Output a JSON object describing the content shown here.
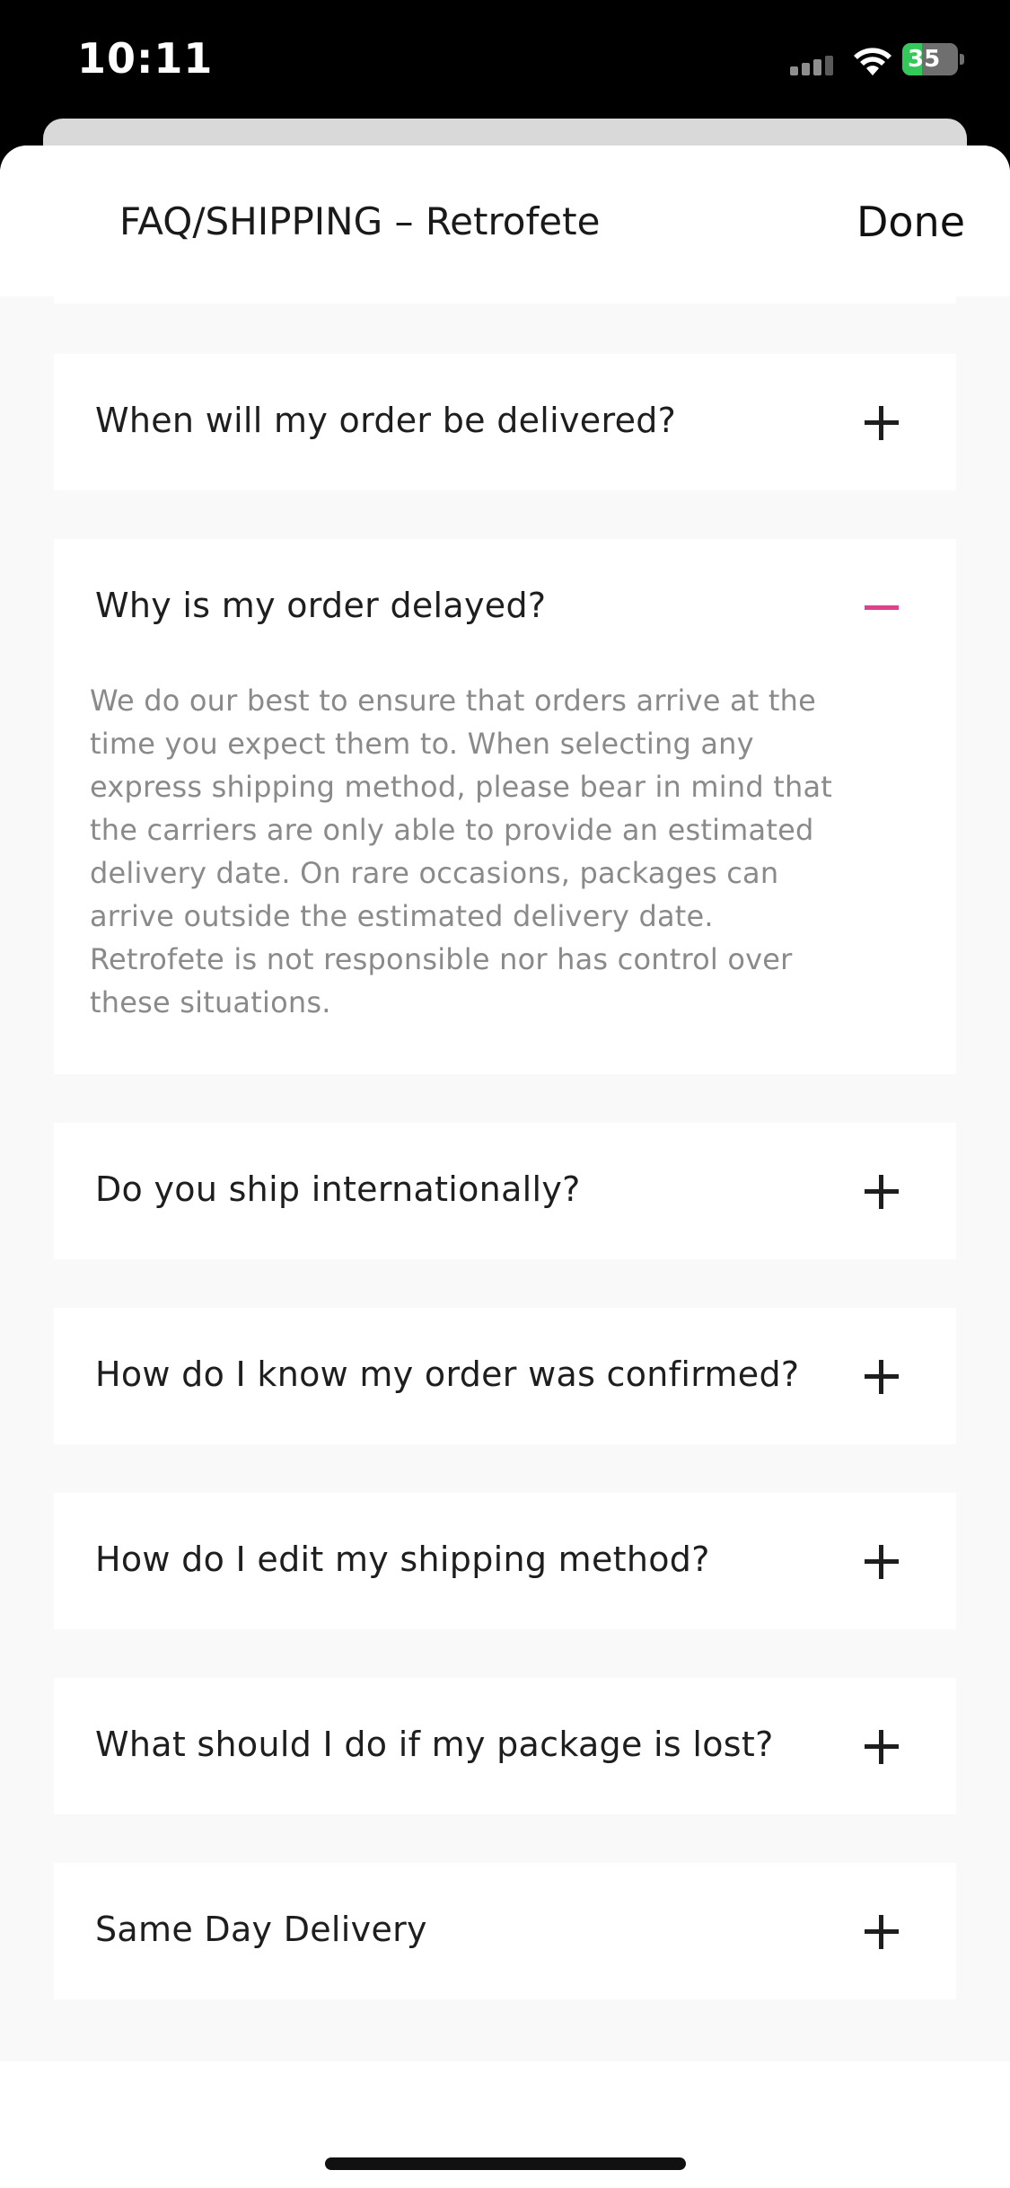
{
  "status_bar": {
    "time": "10:11",
    "battery_level": "35",
    "battery_color": "#34c759"
  },
  "header": {
    "title": "FAQ/SHIPPING – Retrofete",
    "done_label": "Done"
  },
  "accent_color": "#e0418f",
  "faq": {
    "items": [
      {
        "question": "When will my order be delivered?",
        "expanded": false,
        "icon": "plus-icon"
      },
      {
        "question": "Why is my order delayed?",
        "expanded": true,
        "icon": "minus-icon",
        "answer": "We do our best to ensure that orders arrive at the time you expect them to. When selecting any express shipping method, please bear in mind that the carriers are only able to provide an estimated delivery date. On rare occasions, packages can arrive outside the estimated delivery date. Retrofete is not responsible nor has control over these situations."
      },
      {
        "question": "Do you ship internationally?",
        "expanded": false,
        "icon": "plus-icon"
      },
      {
        "question": "How do I know my order was confirmed?",
        "expanded": false,
        "icon": "plus-icon"
      },
      {
        "question": "How do I edit my shipping method?",
        "expanded": false,
        "icon": "plus-icon"
      },
      {
        "question": "What should I do if my package is lost?",
        "expanded": false,
        "icon": "plus-icon"
      },
      {
        "question": "Same Day Delivery",
        "expanded": false,
        "icon": "plus-icon"
      }
    ]
  }
}
